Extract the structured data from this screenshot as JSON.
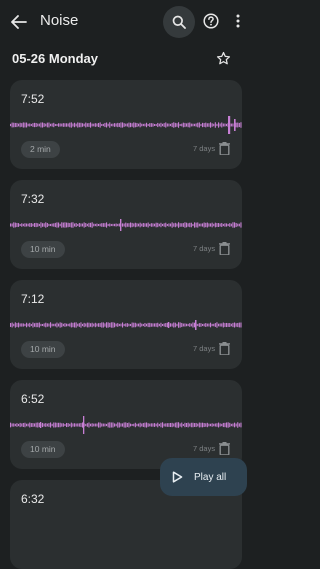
{
  "appbar": {
    "back_icon": "arrow-left-icon",
    "title": "Noise",
    "search_icon": "search-icon",
    "help_icon": "help-circle-icon",
    "more_icon": "more-vertical-icon"
  },
  "date_header": {
    "label": "05-26 Monday",
    "star_icon": "star-outline-icon"
  },
  "recordings": [
    {
      "time": "7:52",
      "duration": "2 min",
      "retention": "7 days"
    },
    {
      "time": "7:32",
      "duration": "10 min",
      "retention": "7 days"
    },
    {
      "time": "7:12",
      "duration": "10 min",
      "retention": "7 days"
    },
    {
      "time": "6:52",
      "duration": "10 min",
      "retention": "7 days"
    },
    {
      "time": "6:32",
      "duration": "",
      "retention": ""
    }
  ],
  "fab": {
    "label": "Play all",
    "icon": "play-outline-icon"
  },
  "colors": {
    "background": "#1d2021",
    "card": "#2b2f30",
    "waveform": "#c77fd4",
    "fab": "#2e4250"
  }
}
